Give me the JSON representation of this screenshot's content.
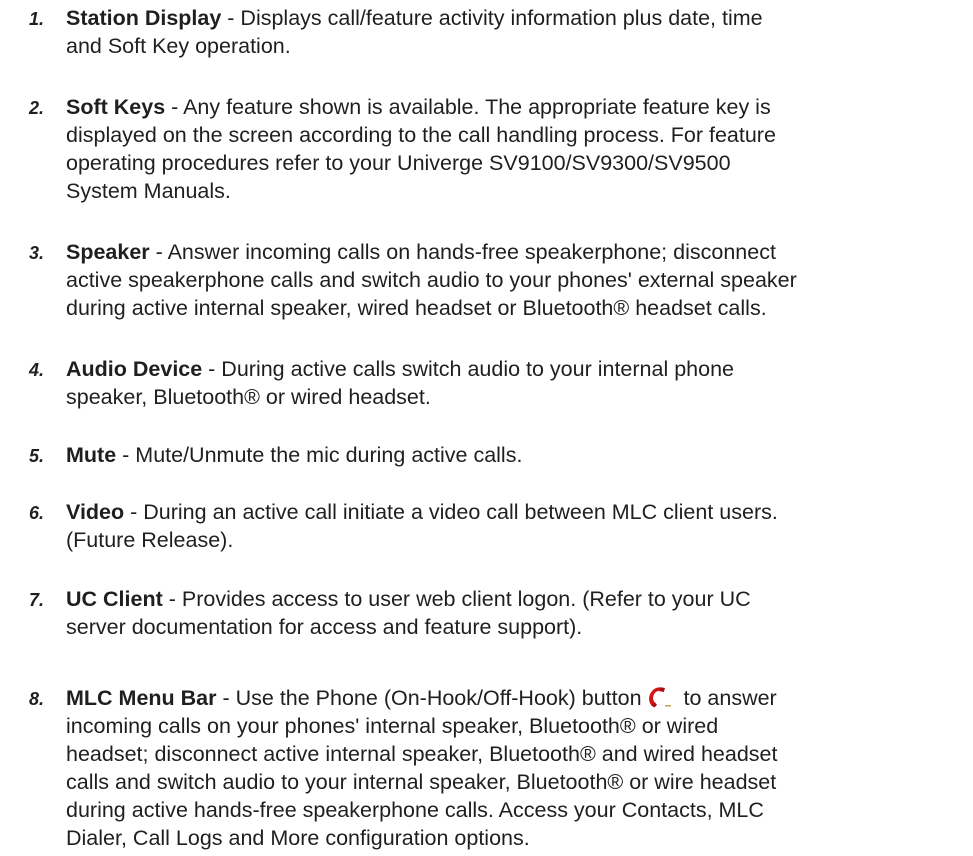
{
  "items": [
    {
      "number": "1.",
      "title": "Station Display",
      "lines": [
        " - Displays call/feature activity information plus date, time",
        "and Soft Key operation."
      ]
    },
    {
      "number": "2.",
      "title": "Soft Keys",
      "lines": [
        " - Any feature shown is available. The appropriate feature key is",
        "displayed on the screen according to the call handling process.   For feature",
        "operating procedures refer to your Univerge SV9100/SV9300/SV9500",
        "System Manuals."
      ]
    },
    {
      "number": "3.",
      "title": "Speaker",
      "lines": [
        " - Answer incoming calls on hands-free speakerphone; disconnect",
        "active speakerphone calls and switch audio to your phones' external speaker",
        "during active internal speaker, wired headset or Bluetooth® headset calls."
      ]
    },
    {
      "number": "4.",
      "title": "Audio Device",
      "lines": [
        " - During active calls switch audio to your internal phone",
        "speaker, Bluetooth® or wired headset."
      ]
    },
    {
      "number": "5.",
      "title": "Mute",
      "lines": [
        " - Mute/Unmute the mic during active calls."
      ]
    },
    {
      "number": "6.",
      "title": "Video",
      "lines": [
        " - During an active call initiate a video call between MLC client users.",
        "(Future Release)."
      ]
    },
    {
      "number": "7.",
      "title": "UC Client",
      "lines": [
        " - Provides access to user web client logon. (Refer to your UC",
        "server documentation for access and feature support)."
      ]
    },
    {
      "number": "8.",
      "title": "MLC Menu Bar",
      "first_line_before_icon": " - Use the Phone (On-Hook/Off-Hook) button",
      "first_line_after_icon": " to answer",
      "icon": "phone-handset-icon",
      "lines": [
        "incoming calls on your phones' internal speaker, Bluetooth® or wired",
        "headset; disconnect active internal speaker, Bluetooth® and wired headset",
        "calls and switch audio to your internal speaker, Bluetooth® or wire headset",
        "during active hands-free speakerphone calls. Access your Contacts, MLC",
        "Dialer, Call Logs and More configuration options."
      ]
    }
  ]
}
